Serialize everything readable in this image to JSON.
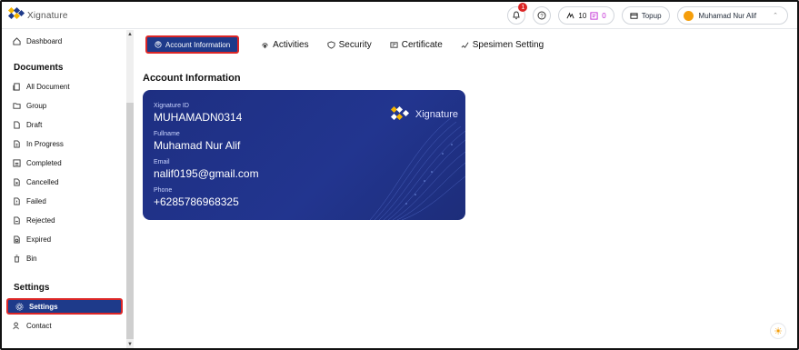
{
  "app": {
    "logo_text": "Xignature"
  },
  "topbar": {
    "notification_count": "1",
    "quota_a": "10",
    "quota_b": "0",
    "topup_label": "Topup",
    "user_name": "Muhamad Nur Alif"
  },
  "sidebar": {
    "dashboard": "Dashboard",
    "documents_title": "Documents",
    "documents_items": [
      "All Document",
      "Group",
      "Draft",
      "In Progress",
      "Completed",
      "Cancelled",
      "Failed",
      "Rejected",
      "Expired",
      "Bin"
    ],
    "settings_title": "Settings",
    "settings_item": "Settings",
    "contact_item": "Contact"
  },
  "tabs": {
    "account": "Account Information",
    "activities": "Activities",
    "security": "Security",
    "certificate": "Certificate",
    "specimen": "Spesimen Setting"
  },
  "main": {
    "heading": "Account Information",
    "card": {
      "logo_text": "Xignature",
      "id_label": "Xignature ID",
      "id_value": "MUHAMADN0314",
      "fullname_label": "Fullname",
      "fullname_value": "Muhamad Nur Alif",
      "email_label": "Email",
      "email_value": "nalif0195@gmail.com",
      "phone_label": "Phone",
      "phone_value": "+6285786968325"
    }
  },
  "colors": {
    "primary": "#1e3a8a",
    "highlight_border": "#dc2626",
    "card_bg": "#22358f",
    "logo_gold": "#f5b400",
    "logo_white": "#ffffff"
  }
}
